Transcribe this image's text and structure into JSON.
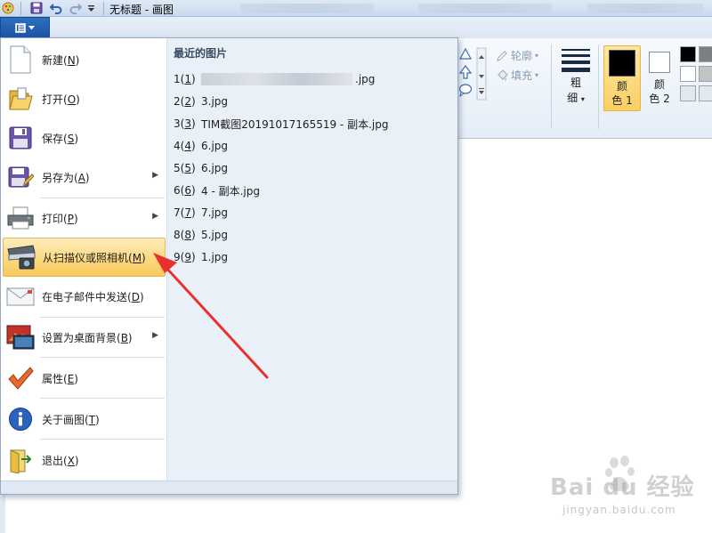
{
  "window": {
    "title": "无标题 - 画图"
  },
  "ribbon": {
    "outline_label": "轮廓",
    "fill_label": "填充",
    "size_label_1": "粗",
    "size_label_2": "细",
    "color1_label_1": "颜",
    "color1_label_2": "色 1",
    "color2_label_1": "颜",
    "color2_label_2": "色 2",
    "color1_value": "#000000",
    "color2_value": "#ffffff"
  },
  "menu": {
    "items": [
      {
        "label": "新建(",
        "key": "N",
        "suffix": ")"
      },
      {
        "label": "打开(",
        "key": "O",
        "suffix": ")"
      },
      {
        "label": "保存(",
        "key": "S",
        "suffix": ")"
      },
      {
        "label": "另存为(",
        "key": "A",
        "suffix": ")"
      },
      {
        "label": "打印(",
        "key": "P",
        "suffix": ")"
      },
      {
        "label": "从扫描仪或照相机(",
        "key": "M",
        "suffix": ")"
      },
      {
        "label": "在电子邮件中发送(",
        "key": "D",
        "suffix": ")"
      },
      {
        "label": "设置为桌面背景(",
        "key": "B",
        "suffix": ")"
      },
      {
        "label": "属性(",
        "key": "E",
        "suffix": ")"
      },
      {
        "label": "关于画图(",
        "key": "T",
        "suffix": ")"
      },
      {
        "label": "退出(",
        "key": "X",
        "suffix": ")"
      }
    ],
    "recent_title": "最近的图片",
    "recent": [
      {
        "num": "1",
        "key": "1",
        "name": ".jpg"
      },
      {
        "num": "2",
        "key": "2",
        "name": "3.jpg"
      },
      {
        "num": "3",
        "key": "3",
        "name": "TIM截图20191017165519 - 副本.jpg"
      },
      {
        "num": "4",
        "key": "4",
        "name": "6.jpg"
      },
      {
        "num": "5",
        "key": "5",
        "name": "6.jpg"
      },
      {
        "num": "6",
        "key": "6",
        "name": "4 - 副本.jpg"
      },
      {
        "num": "7",
        "key": "7",
        "name": "7.jpg"
      },
      {
        "num": "8",
        "key": "8",
        "name": "5.jpg"
      },
      {
        "num": "9",
        "key": "9",
        "name": "1.jpg"
      }
    ]
  },
  "watermark": {
    "text": "Bai du 经验",
    "url": "jingyan.baidu.com"
  },
  "colors": {
    "highlight": "#fbd981",
    "annotation_arrow": "#e8312f",
    "file_tab": "#1b55a3"
  }
}
